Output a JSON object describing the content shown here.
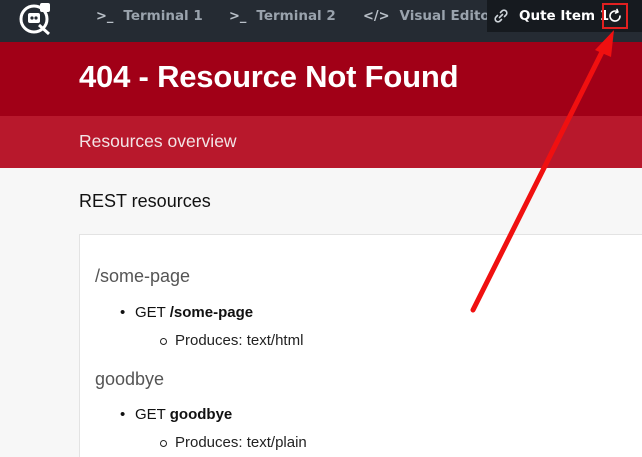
{
  "tabs": [
    {
      "icon": "terminal-prompt-icon",
      "glyph": ">_",
      "label": "Terminal 1"
    },
    {
      "icon": "terminal-prompt-icon",
      "glyph": ">_",
      "label": "Terminal 2"
    },
    {
      "icon": "code-icon",
      "glyph": "</>",
      "label": "Visual Editor"
    }
  ],
  "active_tab": {
    "label": "Qute Item 1",
    "icon": "link-icon"
  },
  "page": {
    "title": "404 - Resource Not Found",
    "subtitle": "Resources overview",
    "section_title": "REST resources"
  },
  "resources": [
    {
      "path": "/some-page",
      "method": "GET",
      "endpoint": "/some-page",
      "produces_label": "Produces:",
      "produces": "text/html"
    },
    {
      "path": "goodbye",
      "method": "GET",
      "endpoint": "goodbye",
      "produces_label": "Produces:",
      "produces": "text/plain"
    }
  ],
  "colors": {
    "topbar": "#252b33",
    "hero": "#a10017",
    "subhero": "#b8182c",
    "annotation": "#e02020"
  }
}
